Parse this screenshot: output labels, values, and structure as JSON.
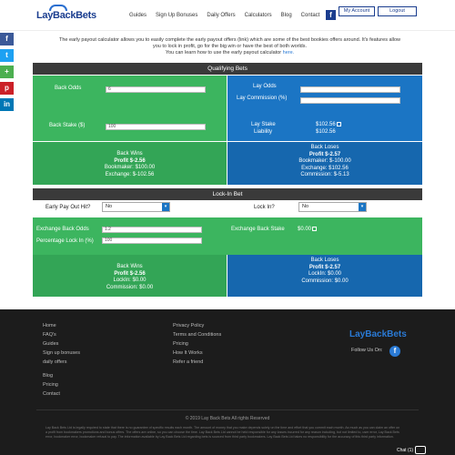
{
  "header": {
    "logo": "LayBackBets",
    "nav": [
      "Guides",
      "Sign Up Bonuses",
      "Daily Offers",
      "Calculators",
      "Blog",
      "Contact"
    ],
    "fb_icon": "facebook-icon",
    "my_account": "My Account",
    "logout": "Logout"
  },
  "social": [
    "f",
    "t",
    "+",
    "p",
    "in"
  ],
  "intro": {
    "line1": "The early payout calculator allows you to easily complete the early payout offers (link) which are some of the best bookies offers around. It's features allow",
    "line2": "you to lock in profit, go for the big win or have the best of both worlds.",
    "line3": "You can learn how to use the early payout calculator",
    "link": "here."
  },
  "qualifying": {
    "title": "Qualifying Bets",
    "back_odds_label": "Back Odds",
    "back_odds_value": "6",
    "lay_odds_label": "Lay Odds",
    "lay_odds_value": "",
    "lay_commission_label": "Lay Commission (%)",
    "lay_commission_value": "",
    "back_stake_label": "Back Stake ($)",
    "back_stake_value": "100",
    "lay_stake_label": "Lay Stake",
    "lay_stake_value": "$102.56",
    "liability_label": "Liability",
    "liability_value": "$102.56",
    "back_wins": {
      "title": "Back Wins",
      "profit": "Profit $-2.56",
      "bookmaker": "Bookmaker: $100.00",
      "exchange": "Exchange: $-102.56"
    },
    "back_loses": {
      "title": "Back Loses",
      "profit": "Profit $-2.57",
      "bookmaker": "Bookmaker: $-100.00",
      "exchange": "Exchange: $102.56",
      "commission": "Commission: $-5.13"
    }
  },
  "lockin": {
    "title": "Lock-In Bet",
    "early_label": "Early Pay Out Hit?",
    "early_value": "No",
    "lockin_label": "Lock In?",
    "lockin_value": "No",
    "exchange_odds_label": "Exchange Back Odds",
    "exchange_odds_value": "1.2",
    "percentage_label": "Percentage Lock In (%)",
    "percentage_value": "100",
    "exchange_stake_label": "Exchange Back Stake",
    "exchange_stake_value": "$0.00",
    "back_wins": {
      "title": "Back Wins",
      "profit": "Profit $-2.56",
      "lockin": "LockIn: $0.00",
      "commission": "Commission: $0.00"
    },
    "back_loses": {
      "title": "Back Loses",
      "profit": "Profit $-2.57",
      "lockin": "LockIn: $0.00",
      "commission": "Commission: $0.00"
    }
  },
  "footer": {
    "col1": [
      "Home",
      "FAQ's",
      "Guides",
      "Sign up bonuses",
      "daily offers"
    ],
    "col1b": [
      "Blog",
      "Pricing",
      "Contact"
    ],
    "col2": [
      "Privacy Policy",
      "Terms and Conditions",
      "Pricing",
      "How It Works",
      "Refer a friend"
    ],
    "logo": "LayBackBets",
    "follow": "Follow Us On:",
    "copyright": "© 2019 Lay Back Bets All rights Reserved",
    "legal": "Lay Back Bets Ltd is legally required to state that there is no guarantee of specific results each month. The amount of money that you make depends solely on the time and effort that you commit each month. As much as you can claim an offer on a profit from bookmakers promotions and bonus offers. The offers are online, so you can choose the time. Lay Back Bets Ltd cannot be held responsible for any losses incurred for any reason including, but not limited to, user error, Lay Back Bets error, bookmaker error, bookmaker refusal to pay. The information available by Lay Back Bets Ltd regarding bets is sourced from third party bookmakers. Lay Back Bets Ltd takes no responsibility for the accuracy of this third party information.",
    "chat": "Chat (1)"
  },
  "colors": {
    "green": "#3cb55f",
    "blue": "#1b75c4",
    "dark_bar": "#3a3a3a",
    "footer_bg": "#1c1c1c"
  }
}
